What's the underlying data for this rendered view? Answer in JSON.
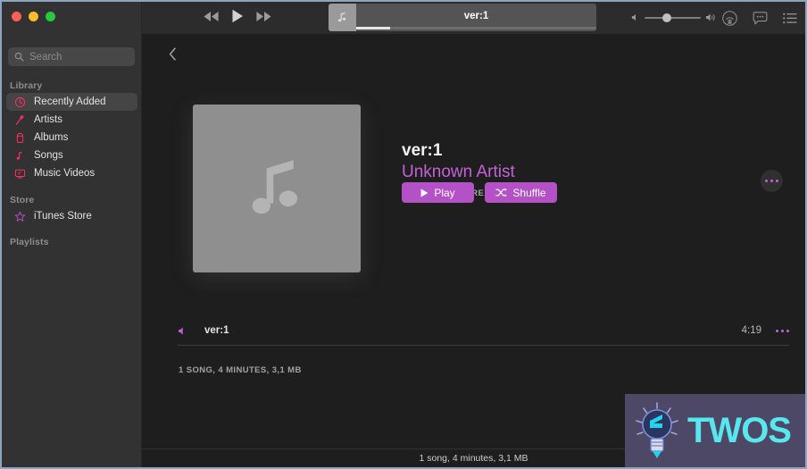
{
  "window": {
    "traffic_lights": [
      "close",
      "minimize",
      "maximize"
    ]
  },
  "sidebar": {
    "search": {
      "placeholder": "Search",
      "value": ""
    },
    "sections": [
      {
        "label": "Library",
        "items": [
          {
            "label": "Recently Added",
            "icon": "clock-icon",
            "active": true
          },
          {
            "label": "Artists",
            "icon": "microphone-icon",
            "active": false
          },
          {
            "label": "Albums",
            "icon": "album-icon",
            "active": false
          },
          {
            "label": "Songs",
            "icon": "music-note-icon",
            "active": false
          },
          {
            "label": "Music Videos",
            "icon": "video-icon",
            "active": false
          }
        ]
      },
      {
        "label": "Store",
        "items": [
          {
            "label": "iTunes Store",
            "icon": "star-icon",
            "active": false
          }
        ]
      },
      {
        "label": "Playlists",
        "items": []
      }
    ],
    "accent_color": "#fa2d5f",
    "store_accent_color": "#b551c7"
  },
  "toolbar": {
    "rewind_label": "Rewind",
    "play_label": "Play",
    "forward_label": "Fast Forward",
    "now_playing": {
      "title": "ver:1",
      "artwork_icon": "music-note-icon",
      "progress_percent": 14
    },
    "volume": {
      "level_percent": 32,
      "min_icon": "speaker-low-icon",
      "max_icon": "speaker-high-icon"
    },
    "icons": [
      "airplay-icon",
      "lyrics-icon",
      "queue-list-icon"
    ]
  },
  "content": {
    "back_button": "Back",
    "album": {
      "title": "ver:1",
      "artist": "Unknown Artist",
      "genre": "UNKNOWN GENRE",
      "rating": 0,
      "rating_max": 5,
      "artwork_icon": "music-note-icon"
    },
    "buttons": {
      "play": "Play",
      "shuffle": "Shuffle",
      "more": "More Options"
    },
    "tracks": [
      {
        "name": "ver:1",
        "duration": "4:19",
        "playing_icon": "speaker-icon"
      }
    ],
    "summary": "1 SONG, 4 MINUTES, 3,1 MB"
  },
  "statusbar": {
    "text": "1 song, 4 minutes, 3,1 MB"
  },
  "watermark": {
    "text": "TWOS",
    "logo_icon": "lightbulb-icon",
    "background_color": "#4d4866",
    "text_color": "#58e7ef"
  },
  "colors": {
    "accent_purple": "#b551c7",
    "artist_purple": "#c561d8",
    "library_pink": "#fa2d5f",
    "window_border": "#8ba6c1"
  }
}
